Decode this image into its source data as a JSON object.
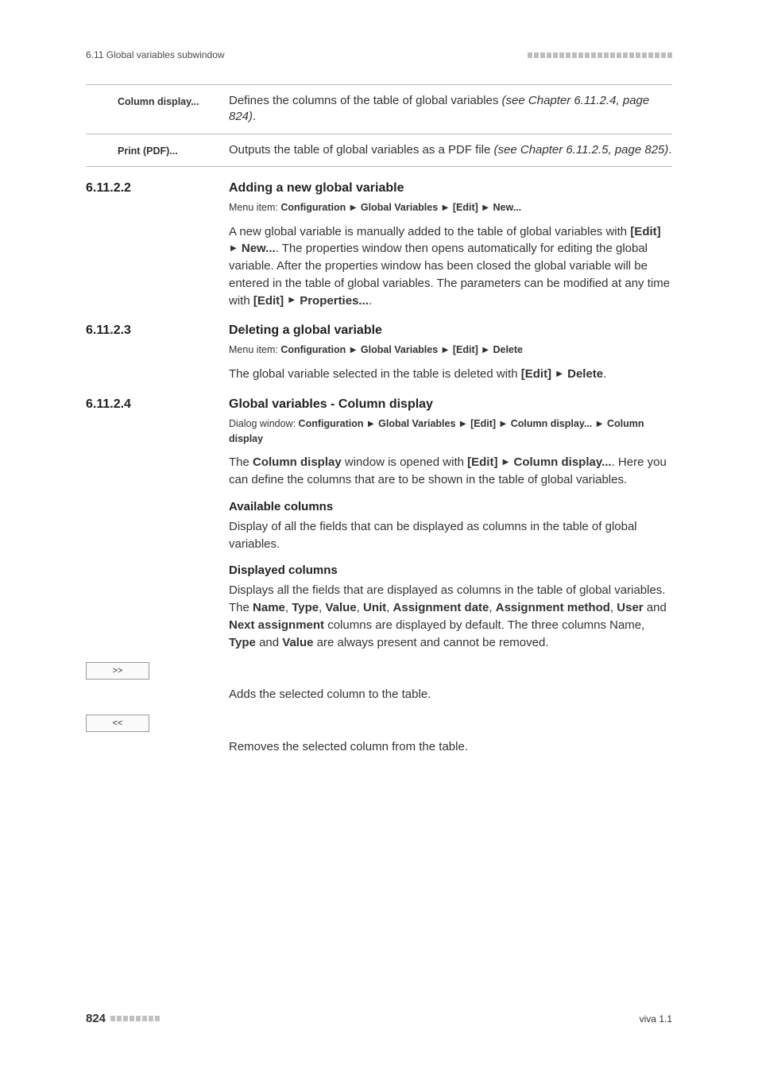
{
  "header": {
    "left": "6.11 Global variables subwindow"
  },
  "defs": [
    {
      "term": "Column display...",
      "desc_a": "Defines the columns of the table of global variables ",
      "desc_ref": "(see Chapter 6.11.2.4, page 824)",
      "desc_b": "."
    },
    {
      "term": "Print (PDF)...",
      "desc_a": "Outputs the table of global variables as a PDF file ",
      "desc_ref": "(see Chapter 6.11.2.5, page 825)",
      "desc_b": "."
    }
  ],
  "sections": {
    "s1": {
      "num": "6.11.2.2",
      "title": "Adding a new global variable",
      "menu_prefix": "Menu item: ",
      "menu_parts": [
        "Configuration",
        "Global Variables",
        "[Edit]",
        "New..."
      ],
      "para_a": "A new global variable is manually added to the table of global variables with ",
      "para_cmd1a": "[Edit]",
      "para_cmd1b": "New...",
      "para_b": ". The properties window then opens automatically for editing the global variable. After the properties window has been closed the global variable will be entered in the table of global variables. The parameters can be modified at any time with ",
      "para_cmd2a": "[Edit]",
      "para_cmd2b": "Properties...",
      "para_c": "."
    },
    "s2": {
      "num": "6.11.2.3",
      "title": "Deleting a global variable",
      "menu_prefix": "Menu item: ",
      "menu_parts": [
        "Configuration",
        "Global Variables",
        "[Edit]",
        "Delete"
      ],
      "para_a": "The global variable selected in the table is deleted with ",
      "para_cmd1a": "[Edit]",
      "para_cmd1b": "Delete",
      "para_b": "."
    },
    "s3": {
      "num": "6.11.2.4",
      "title": "Global variables - Column display",
      "menu_prefix": "Dialog window: ",
      "menu_parts": [
        "Configuration",
        "Global Variables",
        "[Edit]",
        "Column display...",
        "Column display"
      ],
      "para1_a": "The ",
      "para1_b": "Column display",
      "para1_c": " window is opened with ",
      "para1_cmd_a": "[Edit]",
      "para1_cmd_b": "Column display...",
      "para1_d": ". Here you can define the columns that are to be shown in the table of global variables.",
      "sub1": "Available columns",
      "sub1_text": "Display of all the fields that can be displayed as columns in the table of global variables.",
      "sub2": "Displayed columns",
      "sub2_a": "Displays all the fields that are displayed as columns in the table of global variables. The ",
      "cols": [
        "Name",
        "Type",
        "Value",
        "Unit",
        "Assignment date",
        "Assignment method",
        "User",
        "Next assignment"
      ],
      "sub2_b": " columns are displayed by default. The three columns Name, ",
      "sub2_c": "Type",
      "sub2_d": " and ",
      "sub2_e": "Value",
      "sub2_f": " are always present and cannot be removed.",
      "btn_add": ">>",
      "btn_add_text": "Adds the selected column to the table.",
      "btn_remove": "<<",
      "btn_remove_text": "Removes the selected column from the table."
    }
  },
  "footer": {
    "page": "824",
    "right": "viva 1.1"
  }
}
